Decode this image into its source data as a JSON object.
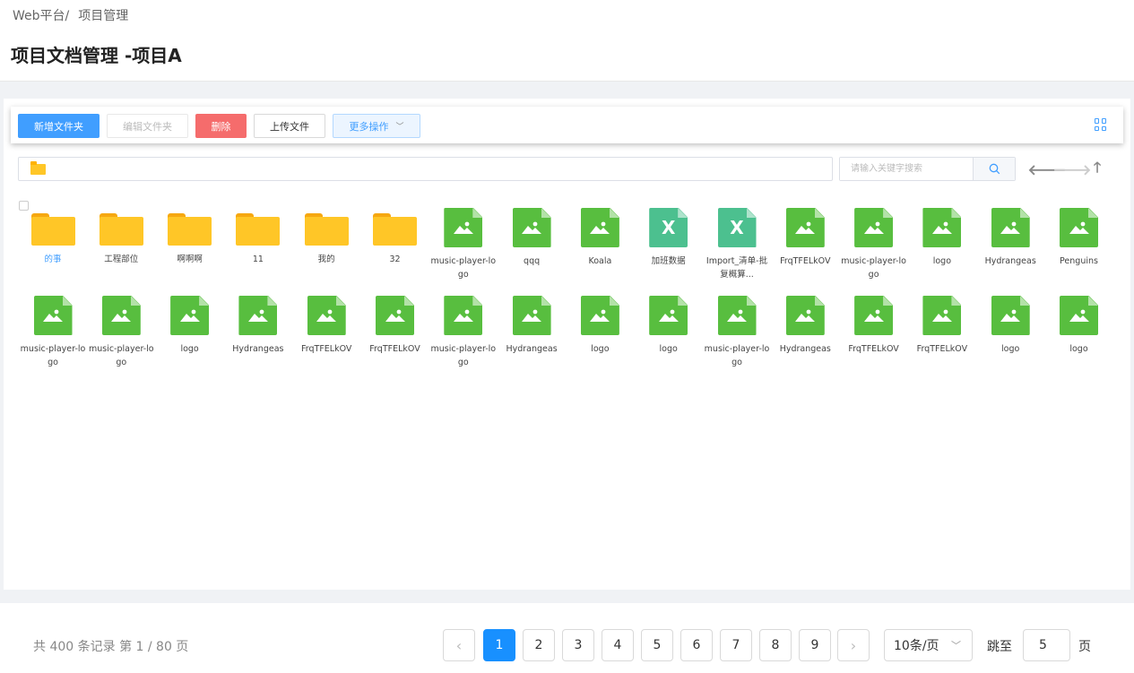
{
  "breadcrumb": {
    "root": "Web平台/",
    "current": "项目管理"
  },
  "page_title": "项目文档管理 -项目A",
  "toolbar": {
    "new_folder": "新增文件夹",
    "edit_folder": "编辑文件夹",
    "delete": "删除",
    "upload": "上传文件",
    "more": "更多操作"
  },
  "search": {
    "placeholder": "请输入关键字搜索"
  },
  "items": [
    {
      "type": "folder",
      "name": "的事",
      "active": true
    },
    {
      "type": "folder",
      "name": "工程部位"
    },
    {
      "type": "folder",
      "name": "啊啊啊"
    },
    {
      "type": "folder",
      "name": "11"
    },
    {
      "type": "folder",
      "name": "我的"
    },
    {
      "type": "folder",
      "name": "32"
    },
    {
      "type": "image",
      "name": "music-player-logo"
    },
    {
      "type": "image",
      "name": "qqq"
    },
    {
      "type": "image",
      "name": "Koala"
    },
    {
      "type": "excel",
      "name": "加班数据"
    },
    {
      "type": "excel",
      "name": "Import_清单-批复概算..."
    },
    {
      "type": "image",
      "name": "FrqTFELkOV"
    },
    {
      "type": "image",
      "name": "music-player-logo"
    },
    {
      "type": "image",
      "name": "logo"
    },
    {
      "type": "image",
      "name": "Hydrangeas"
    },
    {
      "type": "image",
      "name": "Penguins"
    },
    {
      "type": "image",
      "name": "music-player-logo"
    },
    {
      "type": "image",
      "name": "music-player-logo"
    },
    {
      "type": "image",
      "name": "logo"
    },
    {
      "type": "image",
      "name": "Hydrangeas"
    },
    {
      "type": "image",
      "name": "FrqTFELkOV"
    },
    {
      "type": "image",
      "name": "FrqTFELkOV"
    },
    {
      "type": "image",
      "name": "music-player-logo"
    },
    {
      "type": "image",
      "name": "Hydrangeas"
    },
    {
      "type": "image",
      "name": "logo"
    },
    {
      "type": "image",
      "name": "logo"
    },
    {
      "type": "image",
      "name": "music-player-logo"
    },
    {
      "type": "image",
      "name": "Hydrangeas"
    },
    {
      "type": "image",
      "name": "FrqTFELkOV"
    },
    {
      "type": "image",
      "name": "FrqTFELkOV"
    },
    {
      "type": "image",
      "name": "logo"
    },
    {
      "type": "image",
      "name": "logo"
    }
  ],
  "pagination": {
    "total_text": "共 400 条记录 第 1 / 80 页",
    "prev": "‹",
    "next": "›",
    "pages": [
      "1",
      "2",
      "3",
      "4",
      "5",
      "6",
      "7",
      "8",
      "9"
    ],
    "current_page": "1",
    "page_size": "10条/页",
    "jump_label": "跳至",
    "jump_value": "5",
    "page_suffix": "页"
  },
  "colors": {
    "primary": "#409eff",
    "danger": "#f56c6c",
    "folder": "#ffc627",
    "image_file": "#58be3f",
    "excel_file": "#4cc08f",
    "active_page": "#1890ff"
  }
}
